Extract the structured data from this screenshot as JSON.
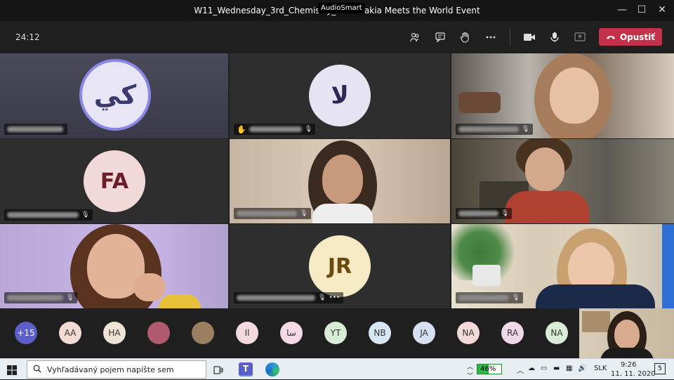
{
  "window": {
    "title": "W11_Wednesday_3rd_Chemistry_... Slovakia Meets the World Event",
    "overlay_badge": "AudioSmart",
    "minimize": "—",
    "maximize": "☐",
    "close": "✕"
  },
  "toolbar": {
    "timer": "24:12",
    "leave_label": "Opustiť",
    "icons": [
      "participants-icon",
      "chat-icon",
      "raise-hand-icon",
      "more-icon",
      "camera-icon",
      "mic-icon",
      "share-icon"
    ]
  },
  "tiles": [
    {
      "kind": "avatar",
      "initials": "كي",
      "bg": "#e8e6f5",
      "fg": "#3b3a6e",
      "ring": "#8b87e8"
    },
    {
      "kind": "avatar",
      "initials": "لا",
      "bg": "#e6e4f3",
      "fg": "#2b2a55"
    },
    {
      "kind": "video"
    },
    {
      "kind": "avatar",
      "initials": "FA",
      "bg": "#f3dada",
      "fg": "#6b1e2a",
      "name": "ZAID SAAD ALAHLAN"
    },
    {
      "kind": "video",
      "name": "Khaled Alida"
    },
    {
      "kind": "video"
    },
    {
      "kind": "video",
      "name": "Veronika"
    },
    {
      "kind": "avatar",
      "initials": "JR",
      "bg": "#f7ebc6",
      "fg": "#6a4a0e"
    },
    {
      "kind": "video",
      "name": "Natália"
    }
  ],
  "strip": {
    "overflow_count": "+15",
    "participants": [
      {
        "initials": "AA",
        "bg": "#f6dbd4"
      },
      {
        "initials": "HA",
        "bg": "#efe3d5"
      },
      {
        "initials": "",
        "bg": "#b05a70"
      },
      {
        "initials": "",
        "bg": "#9a8060"
      },
      {
        "initials": "Il",
        "bg": "#f4d9de"
      },
      {
        "initials": "سا",
        "bg": "#f4d9e6"
      },
      {
        "initials": "YT",
        "bg": "#d9ecd5"
      },
      {
        "initials": "NB",
        "bg": "#d6e6f2"
      },
      {
        "initials": "JA",
        "bg": "#d7e0f2"
      },
      {
        "initials": "NA",
        "bg": "#f4d9d9"
      },
      {
        "initials": "RA",
        "bg": "#f1d8e9"
      },
      {
        "initials": "NA",
        "bg": "#d9ecd5"
      }
    ]
  },
  "taskbar": {
    "search_placeholder": "Vyhľadávaný pojem napíšte sem",
    "battery": "46%",
    "language": "SLK",
    "time": "9:26",
    "date": "11. 11. 2020",
    "notifications": "5"
  }
}
